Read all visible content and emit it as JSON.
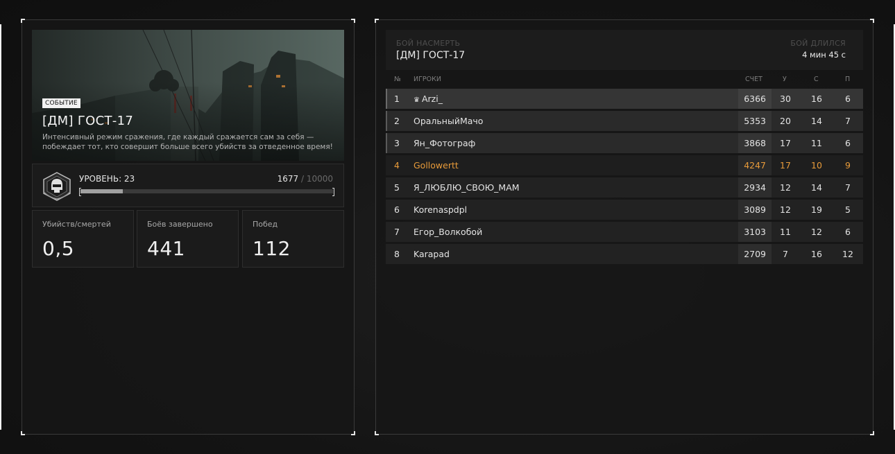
{
  "event": {
    "badge": "СОБЫТИЕ",
    "title": "[ДМ] ГОСТ-17",
    "description": "Интенсивный режим сражения, где каждый сражается сам за себя — побеждает тот, кто совершит больше всего убийств за отведенное время!"
  },
  "level": {
    "label": "УРОВЕНЬ: 23",
    "xp_current": "1677",
    "xp_separator": "/",
    "xp_max": "10000",
    "xp_fraction": 0.1677,
    "emblem_icon": "skull-helmet-emblem-icon"
  },
  "stats": [
    {
      "label": "Убийств/смертей",
      "value": "0,5"
    },
    {
      "label": "Боёв завершено",
      "value": "441"
    },
    {
      "label": "Побед",
      "value": "112"
    }
  ],
  "match": {
    "mode_label": "БОЙ НАСМЕРТЬ",
    "map": "[ДМ] ГОСТ-17",
    "duration_label": "БОЙ ДЛИЛСЯ",
    "duration": "4 мин 45 с"
  },
  "table": {
    "headers": {
      "num": "№",
      "players": "ИГРОКИ",
      "score": "СЧЕТ",
      "u": "У",
      "s": "С",
      "p": "П"
    },
    "rows": [
      {
        "num": "1",
        "name": "Arzi_",
        "score": "6366",
        "u": "30",
        "s": "16",
        "p": "6",
        "crown": "♛"
      },
      {
        "num": "2",
        "name": "ОральныйМачо",
        "score": "5353",
        "u": "20",
        "s": "14",
        "p": "7"
      },
      {
        "num": "3",
        "name": "Ян_Фотограф",
        "score": "3868",
        "u": "17",
        "s": "11",
        "p": "6"
      },
      {
        "num": "4",
        "name": "Gollowertt",
        "score": "4247",
        "u": "17",
        "s": "10",
        "p": "9"
      },
      {
        "num": "5",
        "name": "Я_ЛЮБЛЮ_СВОЮ_МАМ",
        "score": "2934",
        "u": "12",
        "s": "14",
        "p": "7"
      },
      {
        "num": "6",
        "name": "Korenaspdpl",
        "score": "3089",
        "u": "12",
        "s": "19",
        "p": "5"
      },
      {
        "num": "7",
        "name": "Егор_Волкобой",
        "score": "3103",
        "u": "11",
        "s": "12",
        "p": "6"
      },
      {
        "num": "8",
        "name": "Karapad",
        "score": "2709",
        "u": "7",
        "s": "16",
        "p": "12"
      }
    ]
  },
  "colors": {
    "highlight_player": "#e89b3a"
  }
}
